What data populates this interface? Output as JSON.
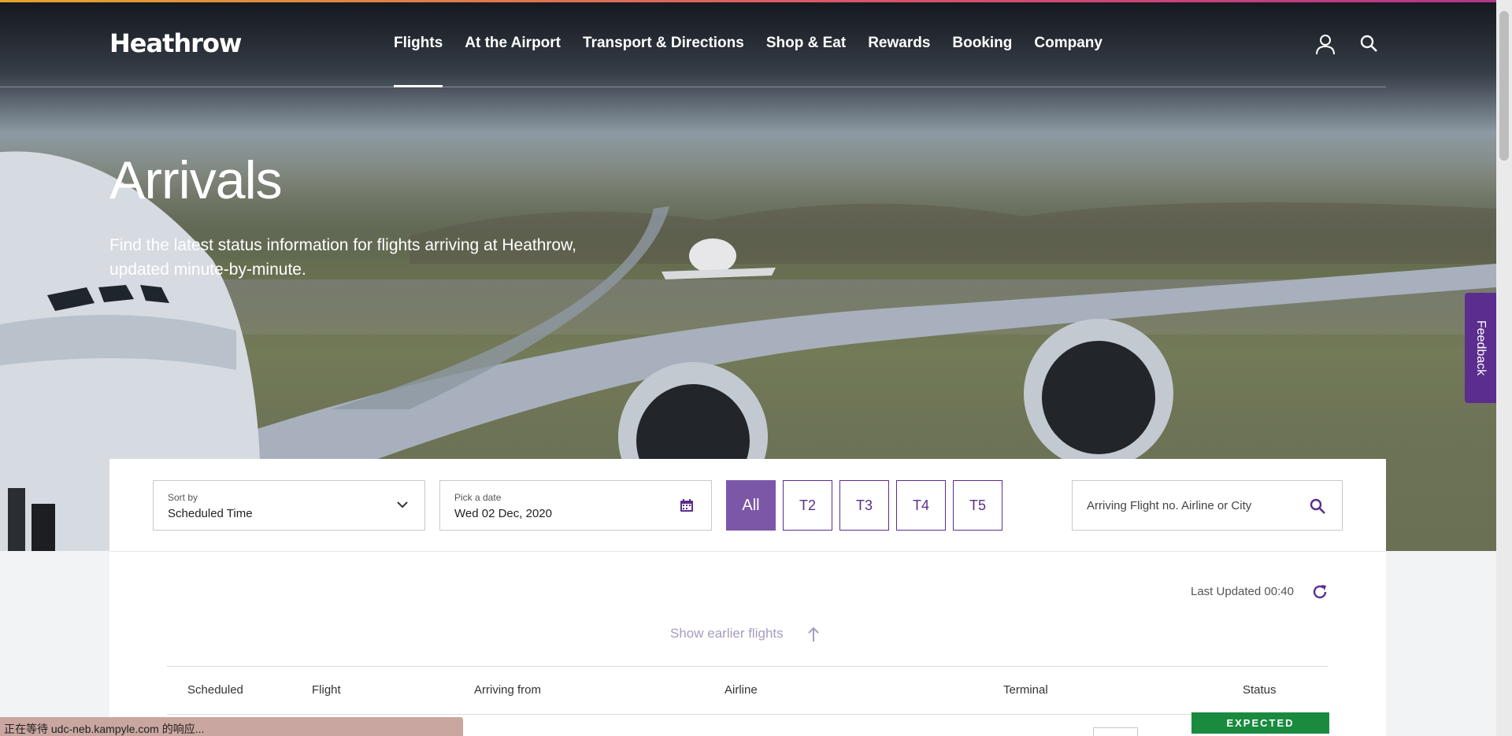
{
  "header": {
    "logo": "Heathrow",
    "nav": [
      "Flights",
      "At the Airport",
      "Transport & Directions",
      "Shop & Eat",
      "Rewards",
      "Booking",
      "Company"
    ],
    "active_nav": "Flights",
    "icons": [
      "user-icon",
      "search-icon"
    ]
  },
  "hero": {
    "title": "Arrivals",
    "description": "Find the latest status information for flights arriving at Heathrow, updated minute-by-minute."
  },
  "feedback": {
    "label": "Feedback"
  },
  "filters": {
    "sort_label": "Sort by",
    "sort_value": "Scheduled Time",
    "date_label": "Pick a date",
    "date_value": "Wed 02 Dec, 2020",
    "terminals": [
      "All",
      "T2",
      "T3",
      "T4",
      "T5"
    ],
    "active_terminal": "All",
    "search_placeholder": "Arriving Flight no. Airline or City"
  },
  "results": {
    "last_updated": "Last Updated 00:40",
    "show_earlier": "Show earlier flights",
    "columns": [
      "Scheduled",
      "Flight",
      "Arriving from",
      "Airline",
      "Terminal",
      "Status"
    ],
    "first_status": "EXPECTED"
  },
  "browser_status": "正在等待 udc-neb.kampyle.com 的响应...",
  "colors": {
    "brand_purple": "#5b2d8e",
    "active_terminal_bg": "#7c57a8",
    "expected_green": "#1a8a3f"
  }
}
